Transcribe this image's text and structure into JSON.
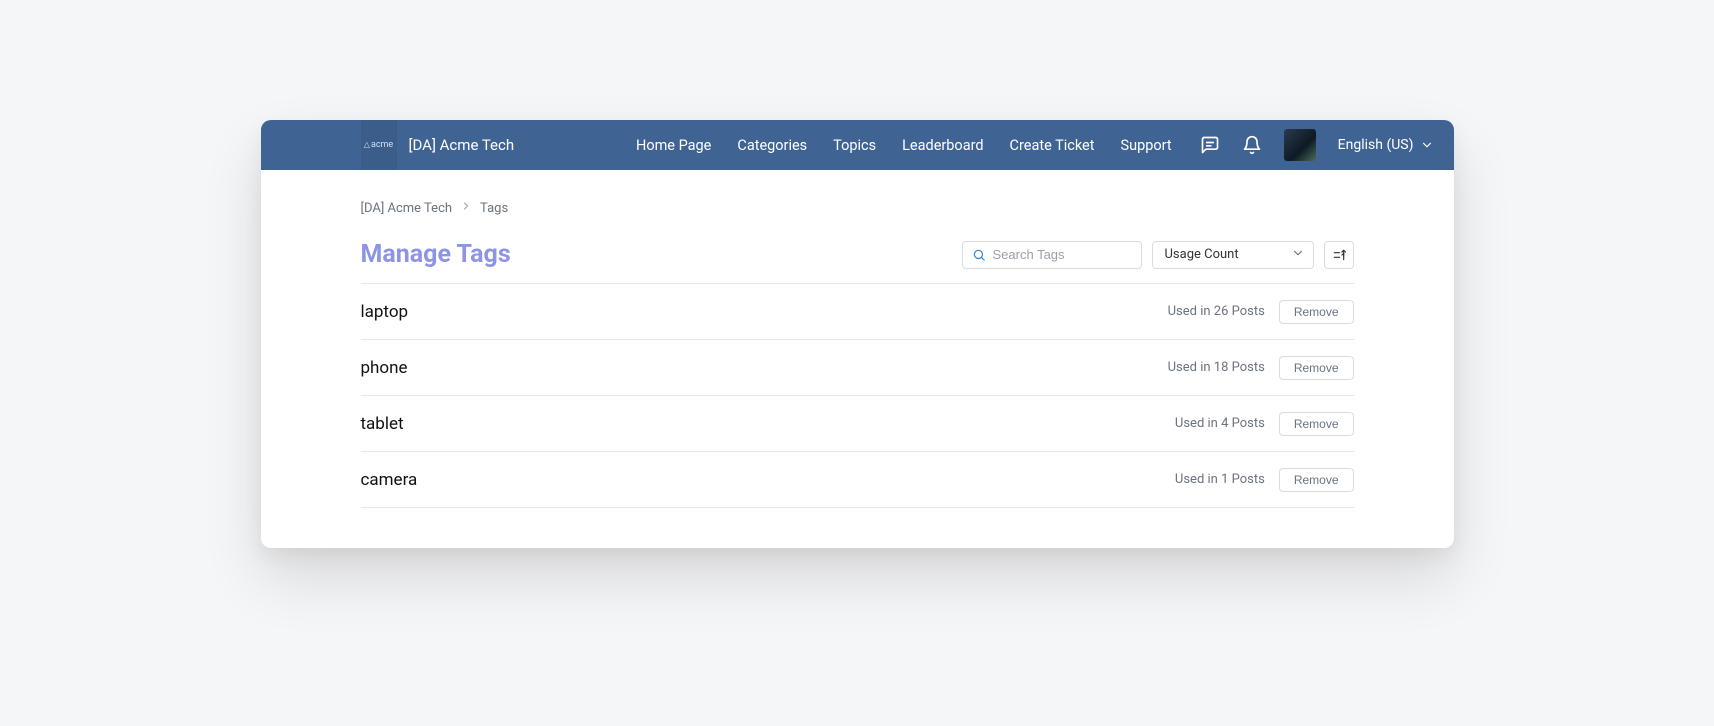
{
  "header": {
    "brand_logo_text": "acme",
    "brand_name": "[DA] Acme Tech",
    "nav": [
      "Home Page",
      "Categories",
      "Topics",
      "Leaderboard",
      "Create Ticket",
      "Support"
    ],
    "language": "English (US)"
  },
  "breadcrumb": {
    "root": "[DA] Acme Tech",
    "current": "Tags"
  },
  "page": {
    "title": "Manage Tags",
    "search_placeholder": "Search Tags",
    "sort_selected": "Usage Count"
  },
  "tags": [
    {
      "name": "laptop",
      "usage": "Used in 26 Posts",
      "remove_label": "Remove"
    },
    {
      "name": "phone",
      "usage": "Used in 18 Posts",
      "remove_label": "Remove"
    },
    {
      "name": "tablet",
      "usage": "Used in 4 Posts",
      "remove_label": "Remove"
    },
    {
      "name": "camera",
      "usage": "Used in 1 Posts",
      "remove_label": "Remove"
    }
  ]
}
